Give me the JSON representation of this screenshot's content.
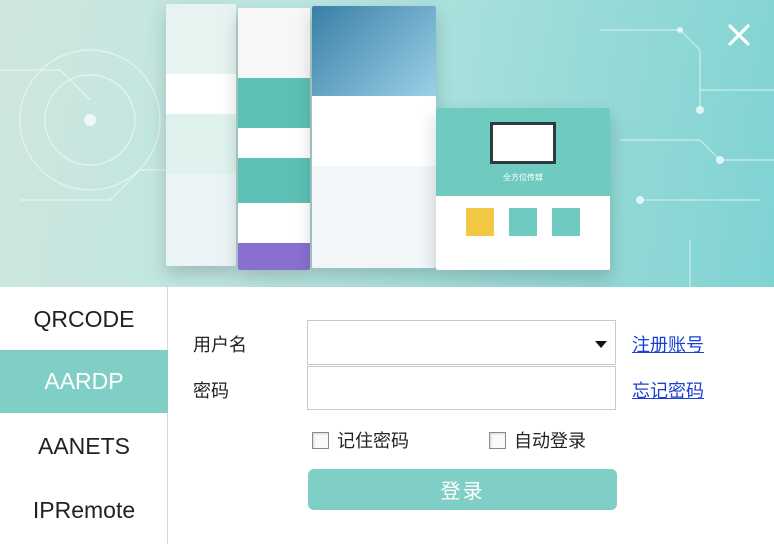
{
  "header": {
    "close_icon": "close-icon",
    "mockup_caption": "全方位传媒"
  },
  "sidebar": {
    "items": [
      {
        "label": "QRCODE",
        "active": false
      },
      {
        "label": "AARDP",
        "active": true
      },
      {
        "label": "AANETS",
        "active": false
      },
      {
        "label": "IPRemote",
        "active": false
      }
    ],
    "active_color": "#7fcfc6"
  },
  "form": {
    "username_label": "用户名",
    "username_value": "",
    "password_label": "密码",
    "password_value": "",
    "register_link": "注册账号",
    "forgot_link": "忘记密码",
    "remember_password": {
      "label": "记住密码",
      "checked": false
    },
    "auto_login": {
      "label": "自动登录",
      "checked": false
    },
    "login_button": "登录"
  },
  "colors": {
    "accent": "#7fcfc6",
    "link": "#1a3fd6"
  }
}
